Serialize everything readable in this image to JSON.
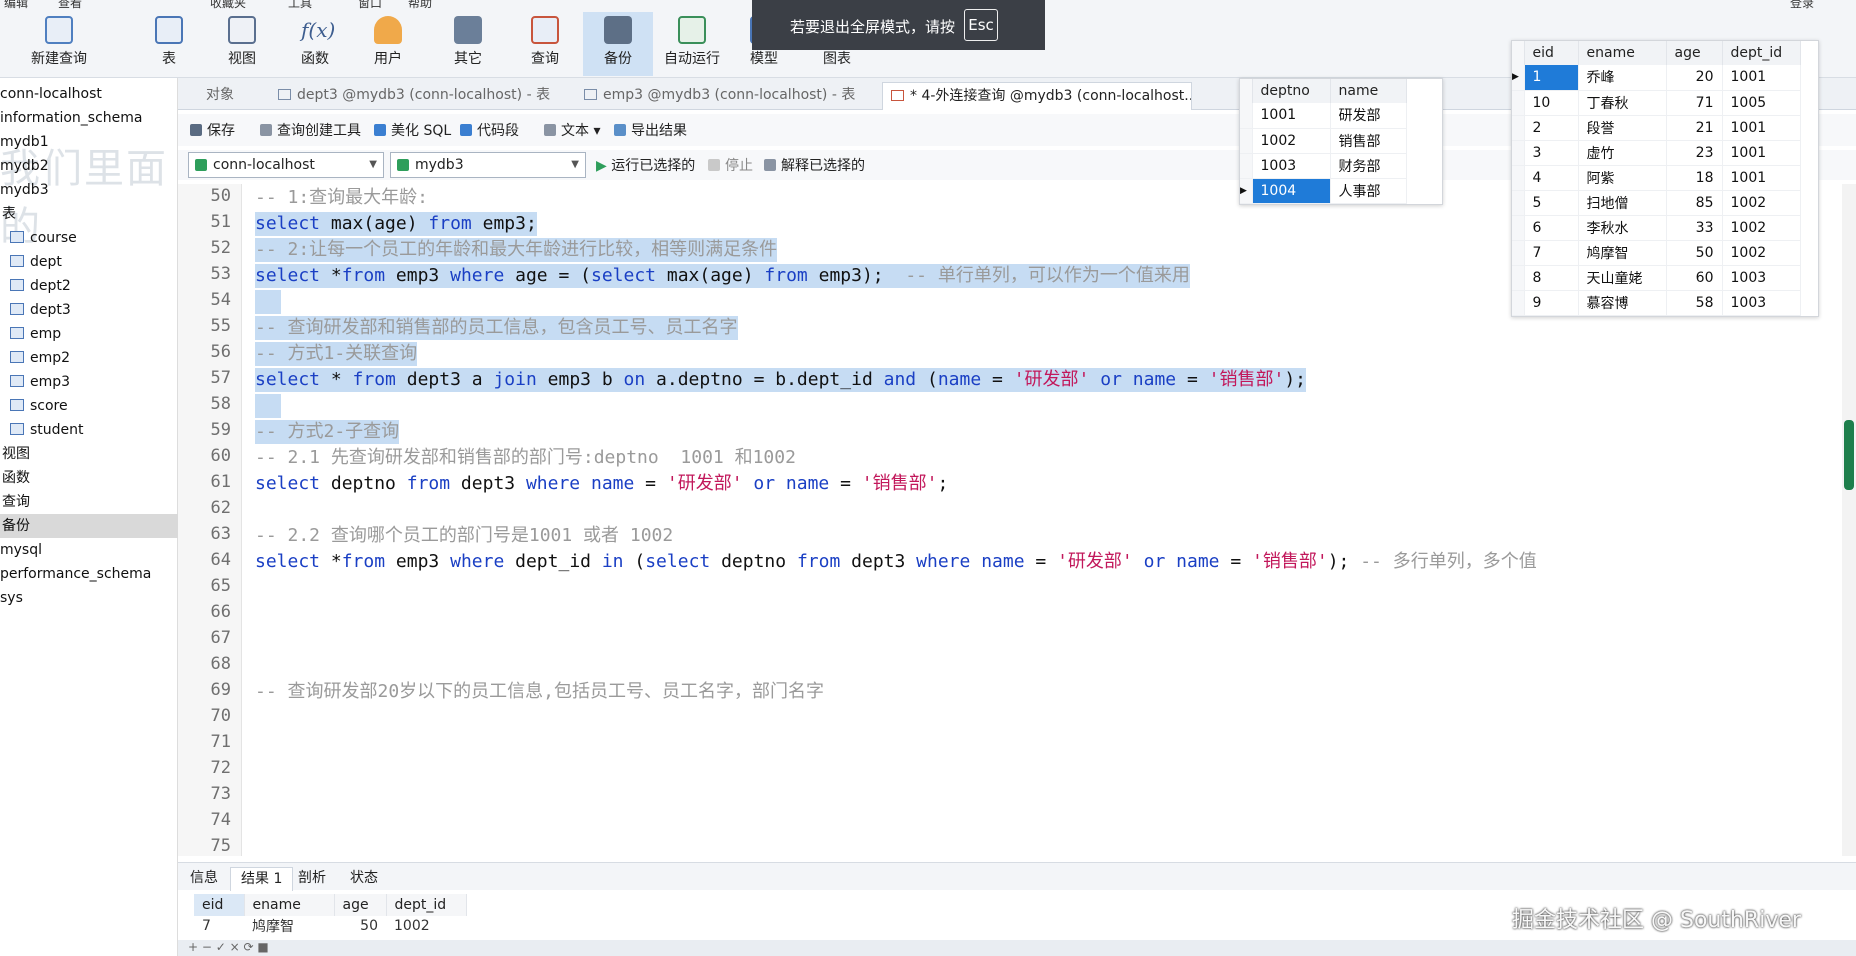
{
  "menu_fragments": [
    "编辑",
    "查看",
    "收藏夹",
    "工具",
    "窗口",
    "帮助",
    "登录"
  ],
  "toolbar": {
    "buttons": [
      {
        "label": "新建查询",
        "icon": "new-query-icon"
      },
      {
        "label": "表",
        "icon": "table-icon"
      },
      {
        "label": "视图",
        "icon": "view-icon"
      },
      {
        "label": "函数",
        "icon": "function-icon"
      },
      {
        "label": "用户",
        "icon": "user-icon"
      },
      {
        "label": "其它",
        "icon": "tools-icon"
      },
      {
        "label": "查询",
        "icon": "query-icon"
      },
      {
        "label": "备份",
        "icon": "backup-icon"
      },
      {
        "label": "自动运行",
        "icon": "auto-run-icon"
      },
      {
        "label": "模型",
        "icon": "model-icon"
      },
      {
        "label": "图表",
        "icon": "chart-icon"
      }
    ]
  },
  "toast": {
    "text": "若要退出全屏模式，请按",
    "key": "Esc"
  },
  "tree": {
    "items": [
      {
        "label": "conn-localhost",
        "indent": 0
      },
      {
        "label": "information_schema",
        "indent": 0
      },
      {
        "label": "mydb1",
        "indent": 0
      },
      {
        "label": "mydb2",
        "indent": 0
      },
      {
        "label": "mydb3",
        "indent": 0
      },
      {
        "label": "表",
        "indent": 1
      },
      {
        "label": "course",
        "indent": 2
      },
      {
        "label": "dept",
        "indent": 2
      },
      {
        "label": "dept2",
        "indent": 2
      },
      {
        "label": "dept3",
        "indent": 2
      },
      {
        "label": "emp",
        "indent": 2
      },
      {
        "label": "emp2",
        "indent": 2
      },
      {
        "label": "emp3",
        "indent": 2
      },
      {
        "label": "score",
        "indent": 2
      },
      {
        "label": "student",
        "indent": 2
      },
      {
        "label": "视图",
        "indent": 1
      },
      {
        "label": "函数",
        "indent": 1
      },
      {
        "label": "查询",
        "indent": 1
      },
      {
        "label": "备份",
        "indent": 1
      },
      {
        "label": "mysql",
        "indent": 0
      },
      {
        "label": "performance_schema",
        "indent": 0
      },
      {
        "label": "sys",
        "indent": 0
      }
    ],
    "watermark": "我们里面的"
  },
  "tabs": {
    "objects": "对象",
    "items": [
      {
        "label": "dept3 @mydb3 (conn-localhost) - 表"
      },
      {
        "label": "emp3 @mydb3 (conn-localhost) - 表"
      },
      {
        "label": "* 4-外连接查询 @mydb3 (conn-localhost..."
      }
    ]
  },
  "query_toolbar": {
    "save": "保存",
    "builder": "查询创建工具",
    "beautify": "美化 SQL",
    "snippet": "代码段",
    "text": "文本",
    "export": "导出结果"
  },
  "connection": {
    "connection": "conn-localhost",
    "database": "mydb3",
    "run_selected": "运行已选择的",
    "stop": "停止",
    "explain": "解释已选择的"
  },
  "editor": {
    "line_numbers": [
      "50",
      "51",
      "52",
      "53",
      "54",
      "55",
      "56",
      "57",
      "58",
      "59",
      "60",
      "61",
      "62",
      "63",
      "64",
      "65",
      "66",
      "67",
      "68",
      "69",
      "70",
      "71",
      "72",
      "73",
      "74",
      "75"
    ],
    "line50": "-- 1:查询最大年龄:",
    "line51": {
      "a": "select",
      "b": " max(age) ",
      "c": "from",
      "d": " emp3;"
    },
    "line52": "-- 2:让每一个员工的年龄和最大年龄进行比较，相等则满足条件",
    "line53": {
      "a": "select",
      "b": " *",
      "c": "from",
      "d": " emp3 ",
      "e": "where",
      "f": " age = (",
      "g": "select",
      "h": " max(age) ",
      "i": "from",
      "j": " emp3);  ",
      "k": "-- 单行单列，可以作为一个值来用"
    },
    "line55": "-- 查询研发部和销售部的员工信息，包含员工号、员工名字",
    "line56": "-- 方式1-关联查询",
    "line57": {
      "a": "select",
      "b": " * ",
      "c": "from",
      "d": " dept3 a ",
      "e": "join",
      "f": " emp3 b ",
      "g": "on",
      "h": " a.deptno = b.dept_id ",
      "i": "and",
      "j": " (",
      "k": "name",
      "l": " = ",
      "m": "'研发部'",
      "n": " ",
      "o": "or",
      "p": " ",
      "q": "name",
      "r": " = ",
      "s": "'销售部'",
      "t": ");"
    },
    "line59": "-- 方式2-子查询",
    "line60": "-- 2.1 先查询研发部和销售部的部门号:deptno  1001 和1002",
    "line61": {
      "a": "select",
      "b": " deptno ",
      "c": "from",
      "d": " dept3 ",
      "e": "where",
      "f": " ",
      "g": "name",
      "h": " = ",
      "i": "'研发部'",
      "j": " ",
      "k": "or",
      "l": " ",
      "m": "name",
      "n": " = ",
      "o": "'销售部'",
      "p": ";"
    },
    "line63": "-- 2.2 查询哪个员工的部门号是1001 或者 1002",
    "line64": {
      "a": "select",
      "b": " *",
      "c": "from",
      "d": " emp3 ",
      "e": "where",
      "f": " dept_id ",
      "g": "in",
      "h": " (",
      "i": "select",
      "j": " deptno ",
      "k": "from",
      "l": " dept3 ",
      "m": "where",
      "n": " ",
      "o": "name",
      "p": " = ",
      "q": "'研发部'",
      "r": " ",
      "s": "or",
      "t": " ",
      "u": "name",
      "v": " = ",
      "w": "'销售部'",
      "x": "); ",
      "y": "-- 多行单列，多个值"
    },
    "line69": "-- 查询研发部20岁以下的员工信息,包括员工号、员工名字，部门名字"
  },
  "dept_table": {
    "headers": [
      "deptno",
      "name"
    ],
    "rows": [
      [
        "1001",
        "研发部"
      ],
      [
        "1002",
        "销售部"
      ],
      [
        "1003",
        "财务部"
      ],
      [
        "1004",
        "人事部"
      ]
    ]
  },
  "emp_table": {
    "headers": [
      "eid",
      "ename",
      "age",
      "dept_id"
    ],
    "rows": [
      [
        "1",
        "乔峰",
        "20",
        "1001"
      ],
      [
        "10",
        "丁春秋",
        "71",
        "1005"
      ],
      [
        "2",
        "段誉",
        "21",
        "1001"
      ],
      [
        "3",
        "虚竹",
        "23",
        "1001"
      ],
      [
        "4",
        "阿紫",
        "18",
        "1001"
      ],
      [
        "5",
        "扫地僧",
        "85",
        "1002"
      ],
      [
        "6",
        "李秋水",
        "33",
        "1002"
      ],
      [
        "7",
        "鸠摩智",
        "50",
        "1002"
      ],
      [
        "8",
        "天山童姥",
        "60",
        "1003"
      ],
      [
        "9",
        "慕容博",
        "58",
        "1003"
      ]
    ]
  },
  "bottom": {
    "tabs": [
      "信息",
      "结果 1",
      "剖析",
      "状态"
    ],
    "result_headers": [
      "eid",
      "ename",
      "age",
      "dept_id"
    ],
    "result_row": [
      "7",
      "鸠摩智",
      "50",
      "1002"
    ]
  },
  "watermark": "掘金技术社区 @ SouthRiver"
}
